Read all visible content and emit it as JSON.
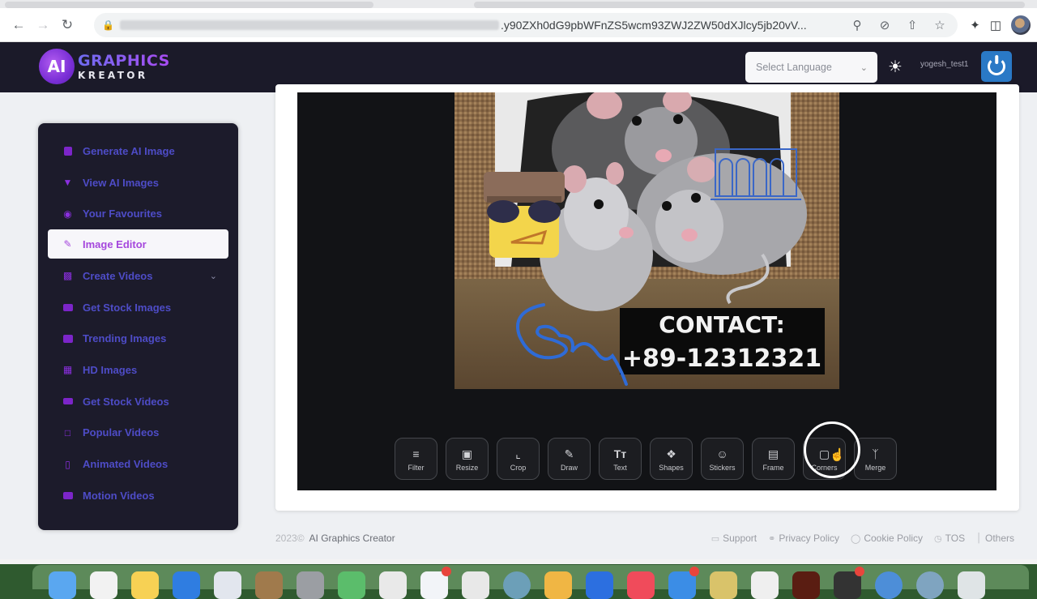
{
  "browser": {
    "url_visible": ".y90ZXh0dG9pbWFnZS5wcm93ZWJ2ZW50dXJlcy5jb20vV...",
    "nav": {
      "back": "back-arrow",
      "forward": "forward-arrow",
      "reload": "reload"
    },
    "omnibox_icons": [
      "zoom-icon",
      "eye-off-icon",
      "share-icon",
      "star-icon"
    ],
    "toolbar_icons": [
      "extensions-icon",
      "side-panel-icon",
      "profile-avatar"
    ]
  },
  "header": {
    "logo_mark": "AI",
    "logo_line1": "GRAPHICS",
    "logo_line2": "KREATOR",
    "language_select": {
      "selected": "Select Language"
    },
    "theme_icon": "sun-icon",
    "username": "yogesh_test1",
    "power_icon": "power-icon"
  },
  "sidebar": {
    "items": [
      {
        "label": "Generate AI Image",
        "icon": "image-icon",
        "active": false
      },
      {
        "label": "View AI Images",
        "icon": "trophy-icon",
        "active": false
      },
      {
        "label": "Your Favourites",
        "icon": "heart-circle-icon",
        "active": false
      },
      {
        "label": "Image Editor",
        "icon": "pencil-icon",
        "active": true
      },
      {
        "label": "Create Videos",
        "icon": "video-icon",
        "active": false,
        "has_submenu": true
      },
      {
        "label": "Get Stock Images",
        "icon": "stock-image-icon",
        "active": false
      },
      {
        "label": "Trending Images",
        "icon": "trending-icon",
        "active": false
      },
      {
        "label": "HD Images",
        "icon": "hd-icon",
        "active": false
      },
      {
        "label": "Get Stock Videos",
        "icon": "stock-video-icon",
        "active": false
      },
      {
        "label": "Popular Videos",
        "icon": "popular-icon",
        "active": false
      },
      {
        "label": "Animated Videos",
        "icon": "file-video-icon",
        "active": false
      },
      {
        "label": "Motion Videos",
        "icon": "film-icon",
        "active": false
      }
    ]
  },
  "editor": {
    "image": {
      "description": "Three grey rats peeking out of a hole in a burlap wall, with stickers and drawing overlays",
      "overlay_text_line1": "CONTACT:",
      "overlay_text_line2": "+89-12312321",
      "stickers": [
        "sunglasses-hat-face-sticker",
        "building-outline-sticker"
      ],
      "drawing": "blue freehand scribble"
    },
    "tools": [
      {
        "label": "Filter",
        "icon": "sliders-icon"
      },
      {
        "label": "Resize",
        "icon": "resize-icon"
      },
      {
        "label": "Crop",
        "icon": "crop-icon"
      },
      {
        "label": "Draw",
        "icon": "draw-icon"
      },
      {
        "label": "Text",
        "icon": "text-icon"
      },
      {
        "label": "Shapes",
        "icon": "shapes-icon"
      },
      {
        "label": "Stickers",
        "icon": "sticker-icon"
      },
      {
        "label": "Frame",
        "icon": "frame-icon"
      },
      {
        "label": "Corners",
        "icon": "corners-icon"
      },
      {
        "label": "Merge",
        "icon": "merge-icon"
      }
    ],
    "hovered_tool": "Corners"
  },
  "footer": {
    "year": "2023©",
    "brand": "AI Graphics Creator",
    "links": [
      {
        "label": "Support",
        "icon": "monitor-icon"
      },
      {
        "label": "Privacy Policy",
        "icon": "key-icon"
      },
      {
        "label": "Cookie Policy",
        "icon": "cookie-icon"
      },
      {
        "label": "TOS",
        "icon": "clock-icon"
      },
      {
        "label": "Others",
        "icon": "bar-icon"
      }
    ]
  },
  "colors": {
    "header_bg": "#1b1a29",
    "sidebar_bg": "#1c1b2b",
    "sidebar_text": "#4e4cc7",
    "sidebar_icon": "#7c25c9",
    "active_text": "#a547dd",
    "canvas_bg": "#121316",
    "power_button": "#2a79c6"
  }
}
